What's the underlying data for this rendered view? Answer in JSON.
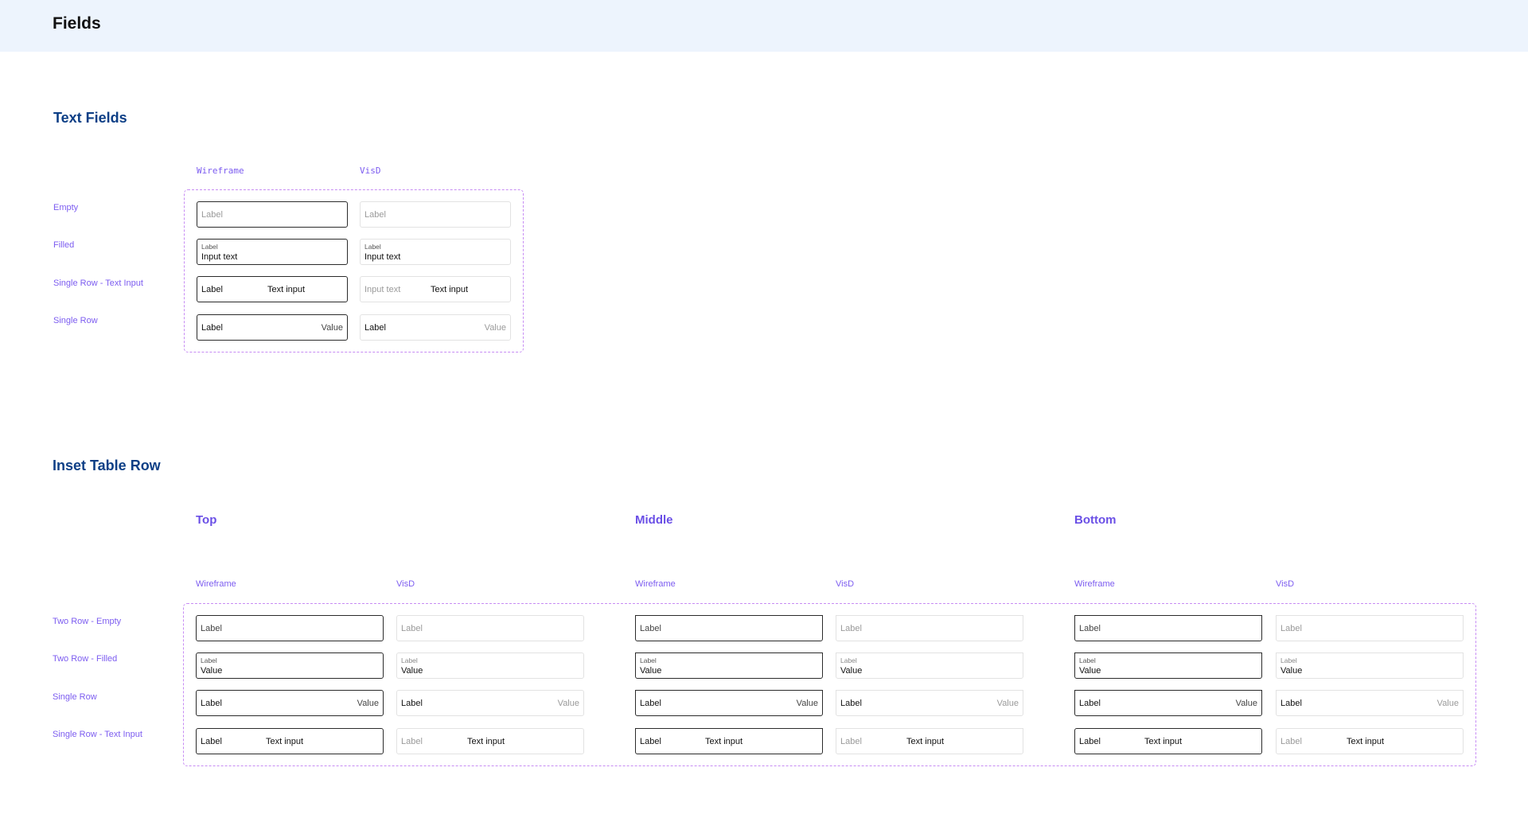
{
  "page": {
    "title": "Fields"
  },
  "text_fields": {
    "title": "Text Fields",
    "columns": {
      "wireframe": "Wireframe",
      "visd": "VisD"
    },
    "rows": {
      "empty": "Empty",
      "filled": "Filled",
      "single_row_text_input": "Single Row - Text Input",
      "single_row": "Single Row"
    },
    "fields": {
      "label": "Label",
      "input_text": "Input text",
      "text_input": "Text input",
      "value": "Value"
    }
  },
  "inset_table_row": {
    "title": "Inset Table Row",
    "groups": {
      "top": "Top",
      "middle": "Middle",
      "bottom": "Bottom"
    },
    "columns": {
      "wireframe": "Wireframe",
      "visd": "VisD"
    },
    "rows": {
      "two_row_empty": "Two Row - Empty",
      "two_row_filled": "Two Row - Filled",
      "single_row": "Single Row",
      "single_row_text_input": "Single Row - Text Input"
    },
    "fields": {
      "label": "Label",
      "value": "Value",
      "text_input": "Text input"
    }
  }
}
